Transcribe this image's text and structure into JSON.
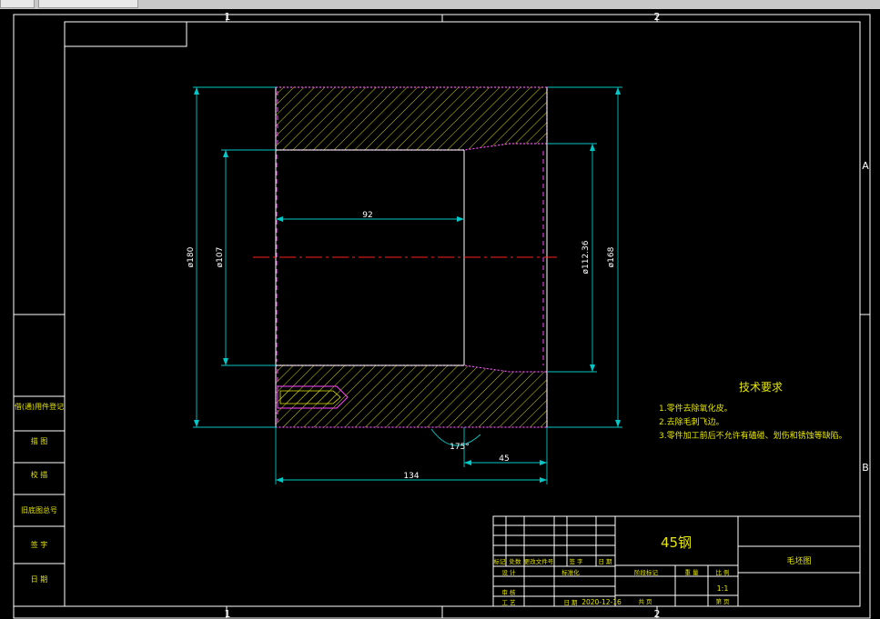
{
  "window": {
    "top_strip_tabs": [
      "",
      ""
    ]
  },
  "border": {
    "zone_numbers_top": [
      "1",
      "2"
    ],
    "zone_numbers_bottom": [
      "1",
      "2"
    ],
    "zone_letters_right": [
      "A",
      "B"
    ]
  },
  "dimensions": {
    "outer_diameter": "ø180",
    "inner_diameter_left": "ø107",
    "inner_diameter_right": "ø112.36",
    "right_diameter": "ø168",
    "length_inner": "92",
    "taper_length": "45",
    "overall_length": "134",
    "angle": "175°"
  },
  "tech_requirements": {
    "title": "技术要求",
    "items": [
      "1.零件去除氧化皮。",
      "2.去除毛刺飞边。",
      "3.零件加工前后不允许有磕碰、划伤和锈蚀等缺陷。"
    ]
  },
  "left_stamp_table": {
    "rows": [
      "借(通)用件登记",
      "描 图",
      "校 描",
      "旧底图总号",
      "签 字",
      "日 期"
    ]
  },
  "title_block": {
    "material": "45钢",
    "drawing_name": "毛坯图",
    "scale": "1:1",
    "date": "2020-12-16",
    "labels": {
      "mark": "标记",
      "count": "处数",
      "zone": "分区",
      "change_doc": "更改文件号",
      "signature": "签 字",
      "date_col": "日 期",
      "design": "设 计",
      "standardize": "标准化",
      "review": "审 核",
      "process": "工 艺",
      "date_label": "日 期",
      "stage_mark": "阶段标记",
      "weight": "重 量",
      "ratio": "比 例",
      "sheets_total": "共 页",
      "sheet_no": "第 页"
    }
  }
}
